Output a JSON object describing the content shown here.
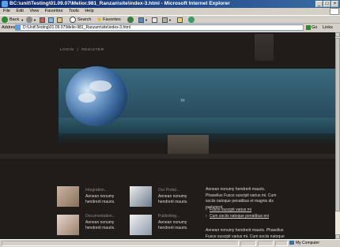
{
  "window": {
    "title": "BC:\\unit\\Testing\\01.09.07\\Melior.981_Ranzan\\site\\index-3.html - Microsoft Internet Explorer"
  },
  "menu": [
    "File",
    "Edit",
    "View",
    "Favorites",
    "Tools",
    "Help"
  ],
  "toolbar": {
    "back": "Back",
    "search": "Search",
    "favorites": "Favorites"
  },
  "address": {
    "label": "Address",
    "value": "D:\\Unit\\Testing\\01.09.07\\Melio-981_Ranzam\\site\\index-3.html",
    "go": "Go",
    "links": "Links"
  },
  "site": {
    "nav": [
      "LOGIN",
      "|",
      "REGISTER"
    ],
    "features": [
      {
        "title": "Integration...",
        "text1": "Aenean nonumy",
        "text2": "hendrerit mauris."
      },
      {
        "title": "Our Portal...",
        "text1": "Aenean nonumy",
        "text2": "hendrerit mauris."
      },
      {
        "title": "Documentation...",
        "text1": "Aenean nonumy",
        "text2": "hendrerit mauris."
      },
      {
        "title": "Publishing...",
        "text1": "Aenean nonumy",
        "text2": "hendrerit mauris."
      }
    ],
    "portal_text": "Aenean nonumy hendrerit mauris. Phasellus Fusce suscipit varius mi. Cum sociis natoque penatibus et magnis dis parturient.",
    "links": [
      "Fusce suscipit varius mi",
      "Cum sociis natoque penatibus eni"
    ],
    "portal_text2": "Aenean nonumy hendrerit mauris. Phasellus Fusce suscipit varius mi. Cum sociis natoque penatibus et magnis dis."
  },
  "status": {
    "zone": "My Computer"
  }
}
